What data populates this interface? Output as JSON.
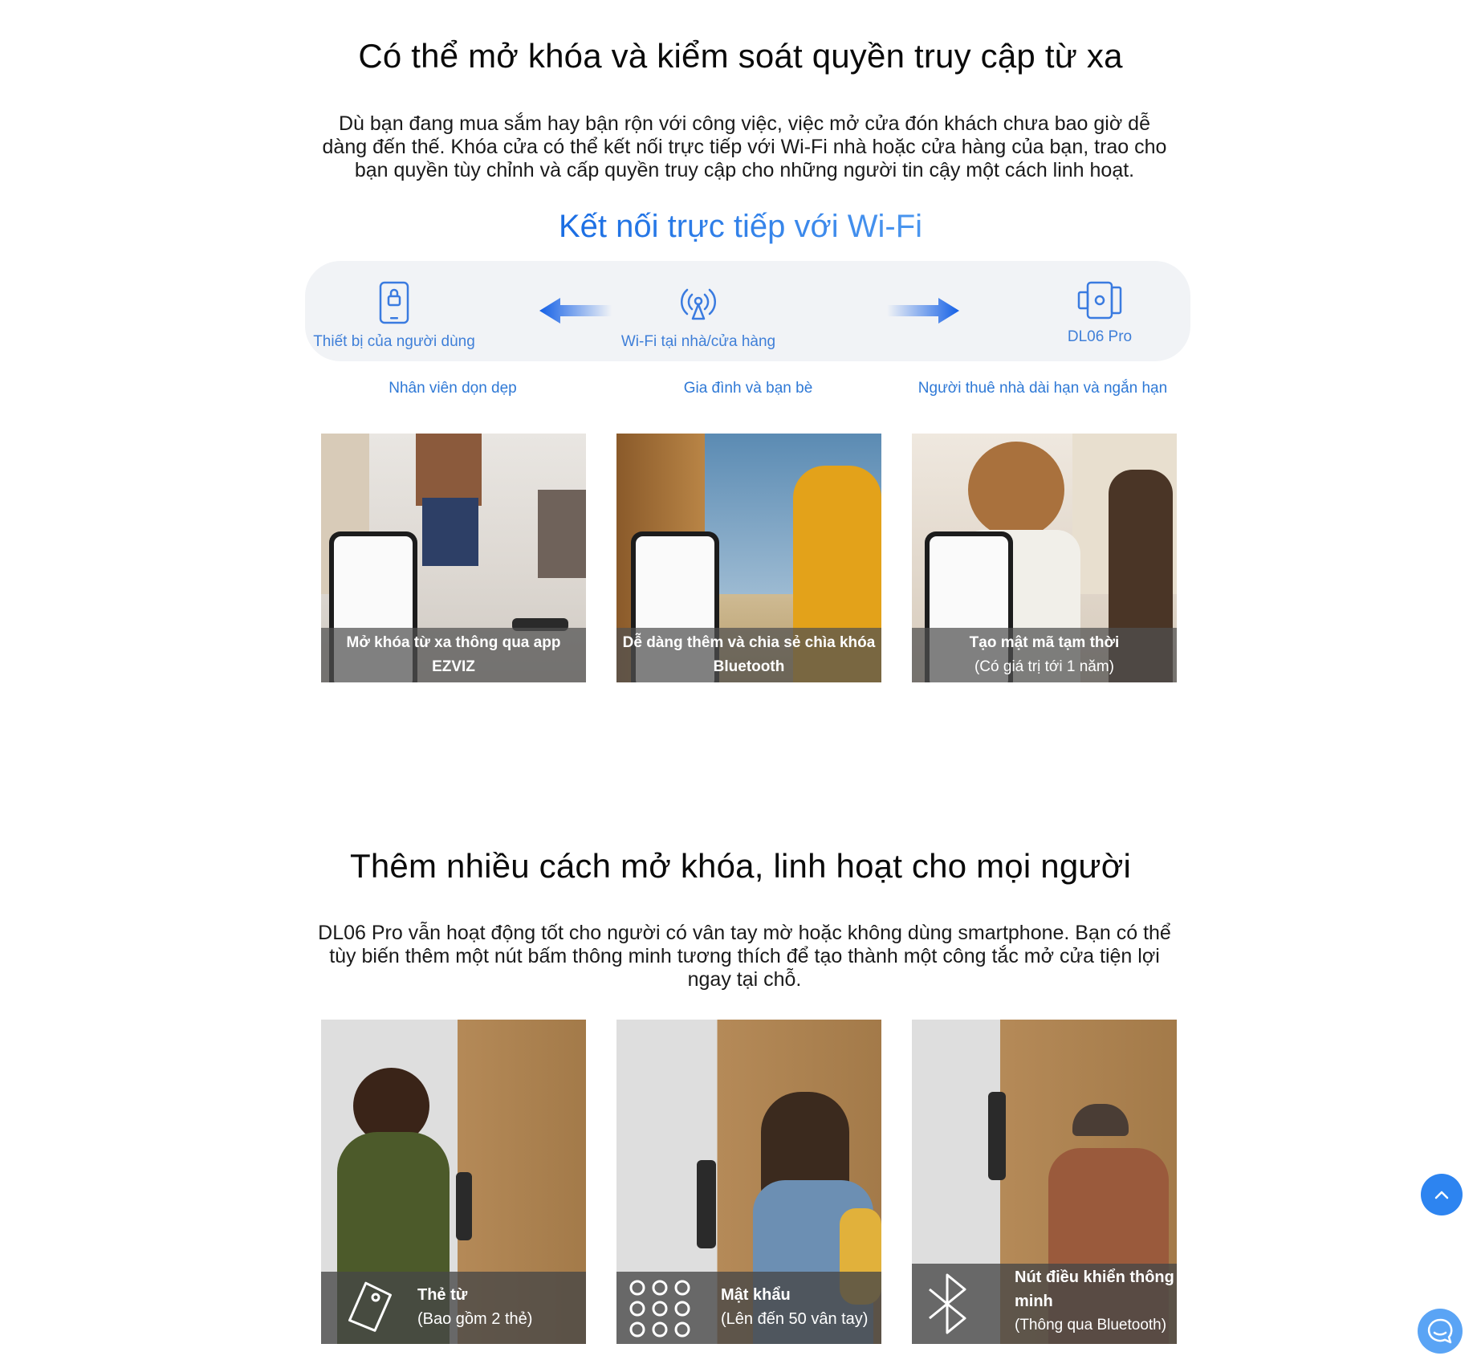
{
  "section1": {
    "title": "Có thể mở khóa và kiểm soát quyền truy cập từ xa",
    "body": "Dù bạn đang mua sắm hay bận rộn với công việc, việc mở cửa đón khách chưa bao giờ dễ dàng đến thế. Khóa cửa có thể kết nối trực tiếp với Wi-Fi nhà hoặc cửa hàng của bạn, trao cho bạn quyền tùy chỉnh và cấp quyền truy cập cho những người tin cậy một cách linh hoạt.",
    "wifi_title": "Kết nối trực tiếp với Wi-Fi",
    "flow": {
      "user_device": "Thiết bị của người dùng",
      "wifi": "Wi-Fi tại nhà/cửa hàng",
      "lock": "DL06 Pro"
    },
    "categories": [
      "Nhân viên dọn dẹp",
      "Gia đình và bạn bè",
      "Người thuê nhà dài hạn và ngắn hạn"
    ],
    "cards": [
      {
        "line1": "Mở khóa từ xa thông qua app",
        "line2": "EZVIZ"
      },
      {
        "line1": "Dễ dàng thêm và chia sẻ chìa khóa",
        "line2": "Bluetooth"
      },
      {
        "line1": "Tạo mật mã tạm thời",
        "line2": "(Có giá trị tới 1 năm)"
      }
    ]
  },
  "section2": {
    "title": "Thêm nhiều cách mở khóa, linh hoạt cho mọi người",
    "body": "DL06 Pro vẫn hoạt động tốt cho người có vân tay mờ hoặc không dùng smartphone. Bạn có thể tùy biến thêm một nút bấm thông minh tương thích để tạo thành một công tắc mở cửa tiện lợi ngay tại chỗ.",
    "cards": [
      {
        "line1": "Thẻ từ",
        "line2": "(Bao gồm 2 thẻ)"
      },
      {
        "line1": "Mật khẩu",
        "line2": "(Lên đến 50 vân tay)"
      },
      {
        "line1": "Nút điều khiển thông minh",
        "line2": "(Thông qua Bluetooth)"
      }
    ]
  },
  "colors": {
    "accent": "#1f6fe0",
    "label_blue": "#3f7fd8",
    "flow_bg": "#f1f3f6"
  },
  "icons": [
    "phone-lock-icon",
    "wifi-signal-icon",
    "door-lock-icon",
    "arrow-left-icon",
    "arrow-right-icon",
    "rfid-card-icon",
    "keypad-icon",
    "bluetooth-icon",
    "chevron-up-icon",
    "chat-icon"
  ]
}
